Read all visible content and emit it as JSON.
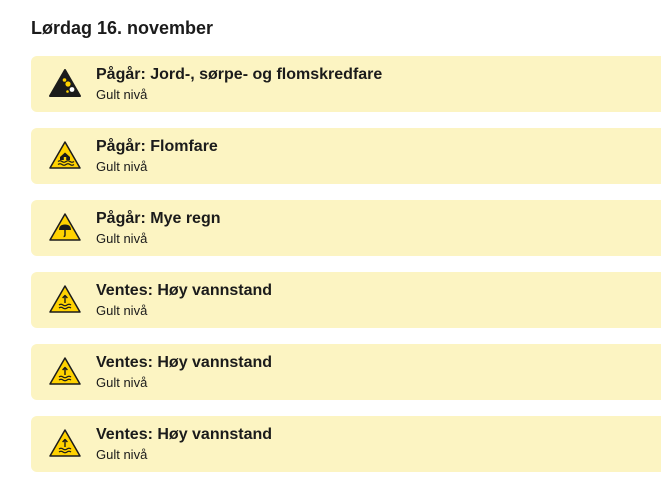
{
  "day": {
    "heading": "Lørdag 16. november"
  },
  "colors": {
    "card_background": "#fcf4c2",
    "warning_yellow": "#ffd200",
    "landslide_black": "#1b1b1b"
  },
  "warnings": [
    {
      "title": "Pågår: Jord-, sørpe- og flomskredfare",
      "level": "Gult nivå",
      "icon": "landslide-icon"
    },
    {
      "title": "Pågår: Flomfare",
      "level": "Gult nivå",
      "icon": "flood-icon"
    },
    {
      "title": "Pågår: Mye regn",
      "level": "Gult nivå",
      "icon": "heavy-rain-icon"
    },
    {
      "title": "Ventes: Høy vannstand",
      "level": "Gult nivå",
      "icon": "high-water-level-icon"
    },
    {
      "title": "Ventes: Høy vannstand",
      "level": "Gult nivå",
      "icon": "high-water-level-icon"
    },
    {
      "title": "Ventes: Høy vannstand",
      "level": "Gult nivå",
      "icon": "high-water-level-icon"
    }
  ]
}
